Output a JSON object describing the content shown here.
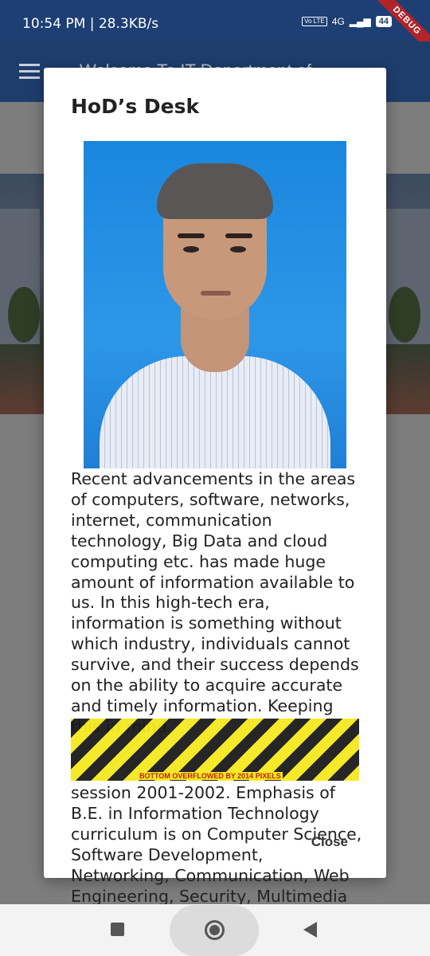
{
  "status_bar": {
    "time": "10:54 PM | 28.3KB/s",
    "network": "4G",
    "battery": "44",
    "volte": "Vo LTE",
    "debug_banner": "DEBUG"
  },
  "app_bar": {
    "title": "Welcome To IT Department of..."
  },
  "dialog": {
    "title": "HoD’s Desk",
    "paragraph_top": "Recent advancements in the areas of computers, software, networks, internet, communication technology, Big Data and cloud computing etc. has made huge amount of information available to us. In this high-tech era, information is something without which industry, individuals cannot survive, and their success depends on the ability to acquire accurate and timely information. Keeping this in mind",
    "paragraph_bottom": "session 2001-2002. Emphasis of B.E. in Information Technology curriculum is on Computer Science, Software Development, Networking, Communication, Web Engineering, Security, Multimedia processing, IoT,",
    "overflow_label": "BOTTOM OVERFLOWED BY 2014 PIXELS",
    "close_label": "Close"
  }
}
